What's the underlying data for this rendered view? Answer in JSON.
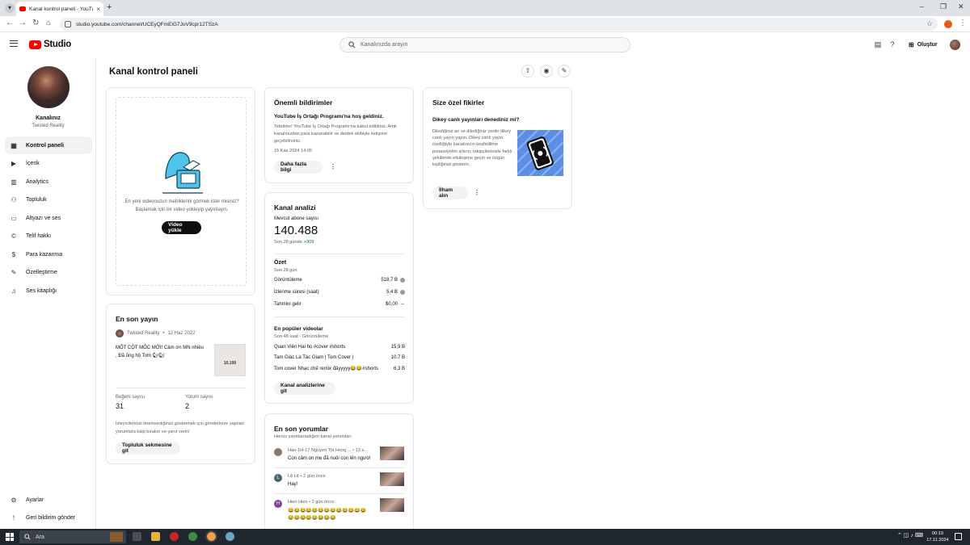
{
  "browser": {
    "tab_title": "Kanal kontrol paneli - YouTube",
    "url": "studio.youtube.com/channel/UCEyQFmEiG7JoV9cpr12TSzA"
  },
  "header": {
    "logo_text": "Studio",
    "search_placeholder": "Kanalınızda arayın",
    "create_label": "Oluştur"
  },
  "sidebar": {
    "channel_name": "Kanalınız",
    "channel_handle": "Twisted Reality",
    "items": [
      {
        "label": "Kontrol paneli",
        "icon": "dashboard-icon"
      },
      {
        "label": "İçerik",
        "icon": "content-icon"
      },
      {
        "label": "Analytics",
        "icon": "analytics-icon"
      },
      {
        "label": "Topluluk",
        "icon": "community-icon"
      },
      {
        "label": "Altyazı ve ses",
        "icon": "subtitles-icon"
      },
      {
        "label": "Telif hakkı",
        "icon": "copyright-icon"
      },
      {
        "label": "Para kazanma",
        "icon": "monetization-icon"
      },
      {
        "label": "Özelleştirme",
        "icon": "customization-icon"
      },
      {
        "label": "Ses kitaplığı",
        "icon": "audio-library-icon"
      }
    ],
    "settings_label": "Ayarlar",
    "feedback_label": "Geri bildirim gönder"
  },
  "main": {
    "page_title": "Kanal kontrol paneli",
    "upload_card": {
      "text": "En yeni videonuzun metriklerini görmek ister misiniz? Başlamak için bir video yükleyip yayınlayın.",
      "button": "Video yükle"
    },
    "latest_post": {
      "title": "En son yayın",
      "author": "Twisted Reality",
      "date": "12 Haz 2022",
      "text": "MỐT CỘT MỐC MỚI! Cảm ơn MN nhiều , Đã ủng hộ Tom 🐿🐿",
      "thumb_text": "10,100",
      "likes_label": "Beğeni sayısı",
      "likes": "31",
      "comments_label": "Yorum sayısı",
      "comments": "2",
      "note": "İzleyicilerinizi önemsediğinizi göstermek için gönderinize yapılan yorumlara kalp bırakın ve yanıt verin!",
      "button": "Topluluk sekmesine git"
    },
    "notifications": {
      "title": "Önemli bildirimler",
      "headline": "YouTube İş Ortağı Programı'na hoş geldiniz.",
      "body": "Tebrikler! YouTube İş Ortağı Programı'na kabul edildiniz. Artık kanalınızdan para kazanabilir ve destek ekibiyle iletişime geçebilirsiniz.",
      "date": "15 Kas 2024 14:05",
      "button": "Daha fazla bilgi"
    },
    "analytics": {
      "title": "Kanal analizi",
      "subs_label": "Mevcut abone sayısı",
      "subs_value": "140.488",
      "subs_period": "Son 28 günde",
      "subs_delta": "+909",
      "summary_title": "Özet",
      "summary_period": "Son 28 gün",
      "summary_rows": [
        {
          "label": "Görüntüleme",
          "value": "518,7 B",
          "icon": "info-icon"
        },
        {
          "label": "İzlenme süresi (saat)",
          "value": "5,4 B",
          "icon": "info-icon"
        },
        {
          "label": "Tahmini gelir",
          "value": "$0,00",
          "icon": "dash"
        }
      ],
      "top_title": "En popüler videolar",
      "top_period": "Son 48 saat · Görüntüleme",
      "top_videos": [
        {
          "title": "Quan Viên Hai họ #cover #shorts",
          "views": "15,9 B"
        },
        {
          "title": "Tam Giác Là Tác Giam | Tom Cover |",
          "views": "10,7 B"
        },
        {
          "title": "Tom cover Nhạc chế remix đâyyyyy😂😂#shorts",
          "views": "6,3 B"
        }
      ],
      "button": "Kanal analizlerine git"
    },
    "comments": {
      "title": "En son yorumlar",
      "subtitle": "Henüz yanıtlamadığım kanal yorumları",
      "items": [
        {
          "meta": "Han-1H-17 Nguyen Thi Hong ... • 13 s...",
          "text": "Con cảm on mẹ đã nuôi con lên người",
          "avatar": "",
          "color": "#8a7a6a"
        },
        {
          "meta": "Lệ Lệ • 2 gün önce",
          "text": "Hay!",
          "avatar": "L",
          "color": "#4a6572"
        },
        {
          "meta": "Hien Hien • 2 gün önce",
          "text": "😂😂😂😂😂😂😂😂😂😂😂😂😂😂😂😂😂😂😂😂😂",
          "avatar": "H",
          "color": "#7b3fa0"
        }
      ]
    },
    "ideas": {
      "title": "Size özel fikirler",
      "headline": "Dikey canlı yayınları denediniz mi?",
      "body": "Dilediğiniz an ve dilediğiniz yerde dikey canlı yayın yapın. Dikey canlı yayın özelliğiyle kanalınızın keşfedilme potansiyelini artırın, takipçilerinizle farklı şekillerde etkileşime geçin ve özgün kişiliğinizi gösterin.",
      "button": "İlham alın"
    }
  },
  "taskbar": {
    "search_placeholder": "Ara",
    "time": "00:19",
    "date": "17.11.2024"
  }
}
